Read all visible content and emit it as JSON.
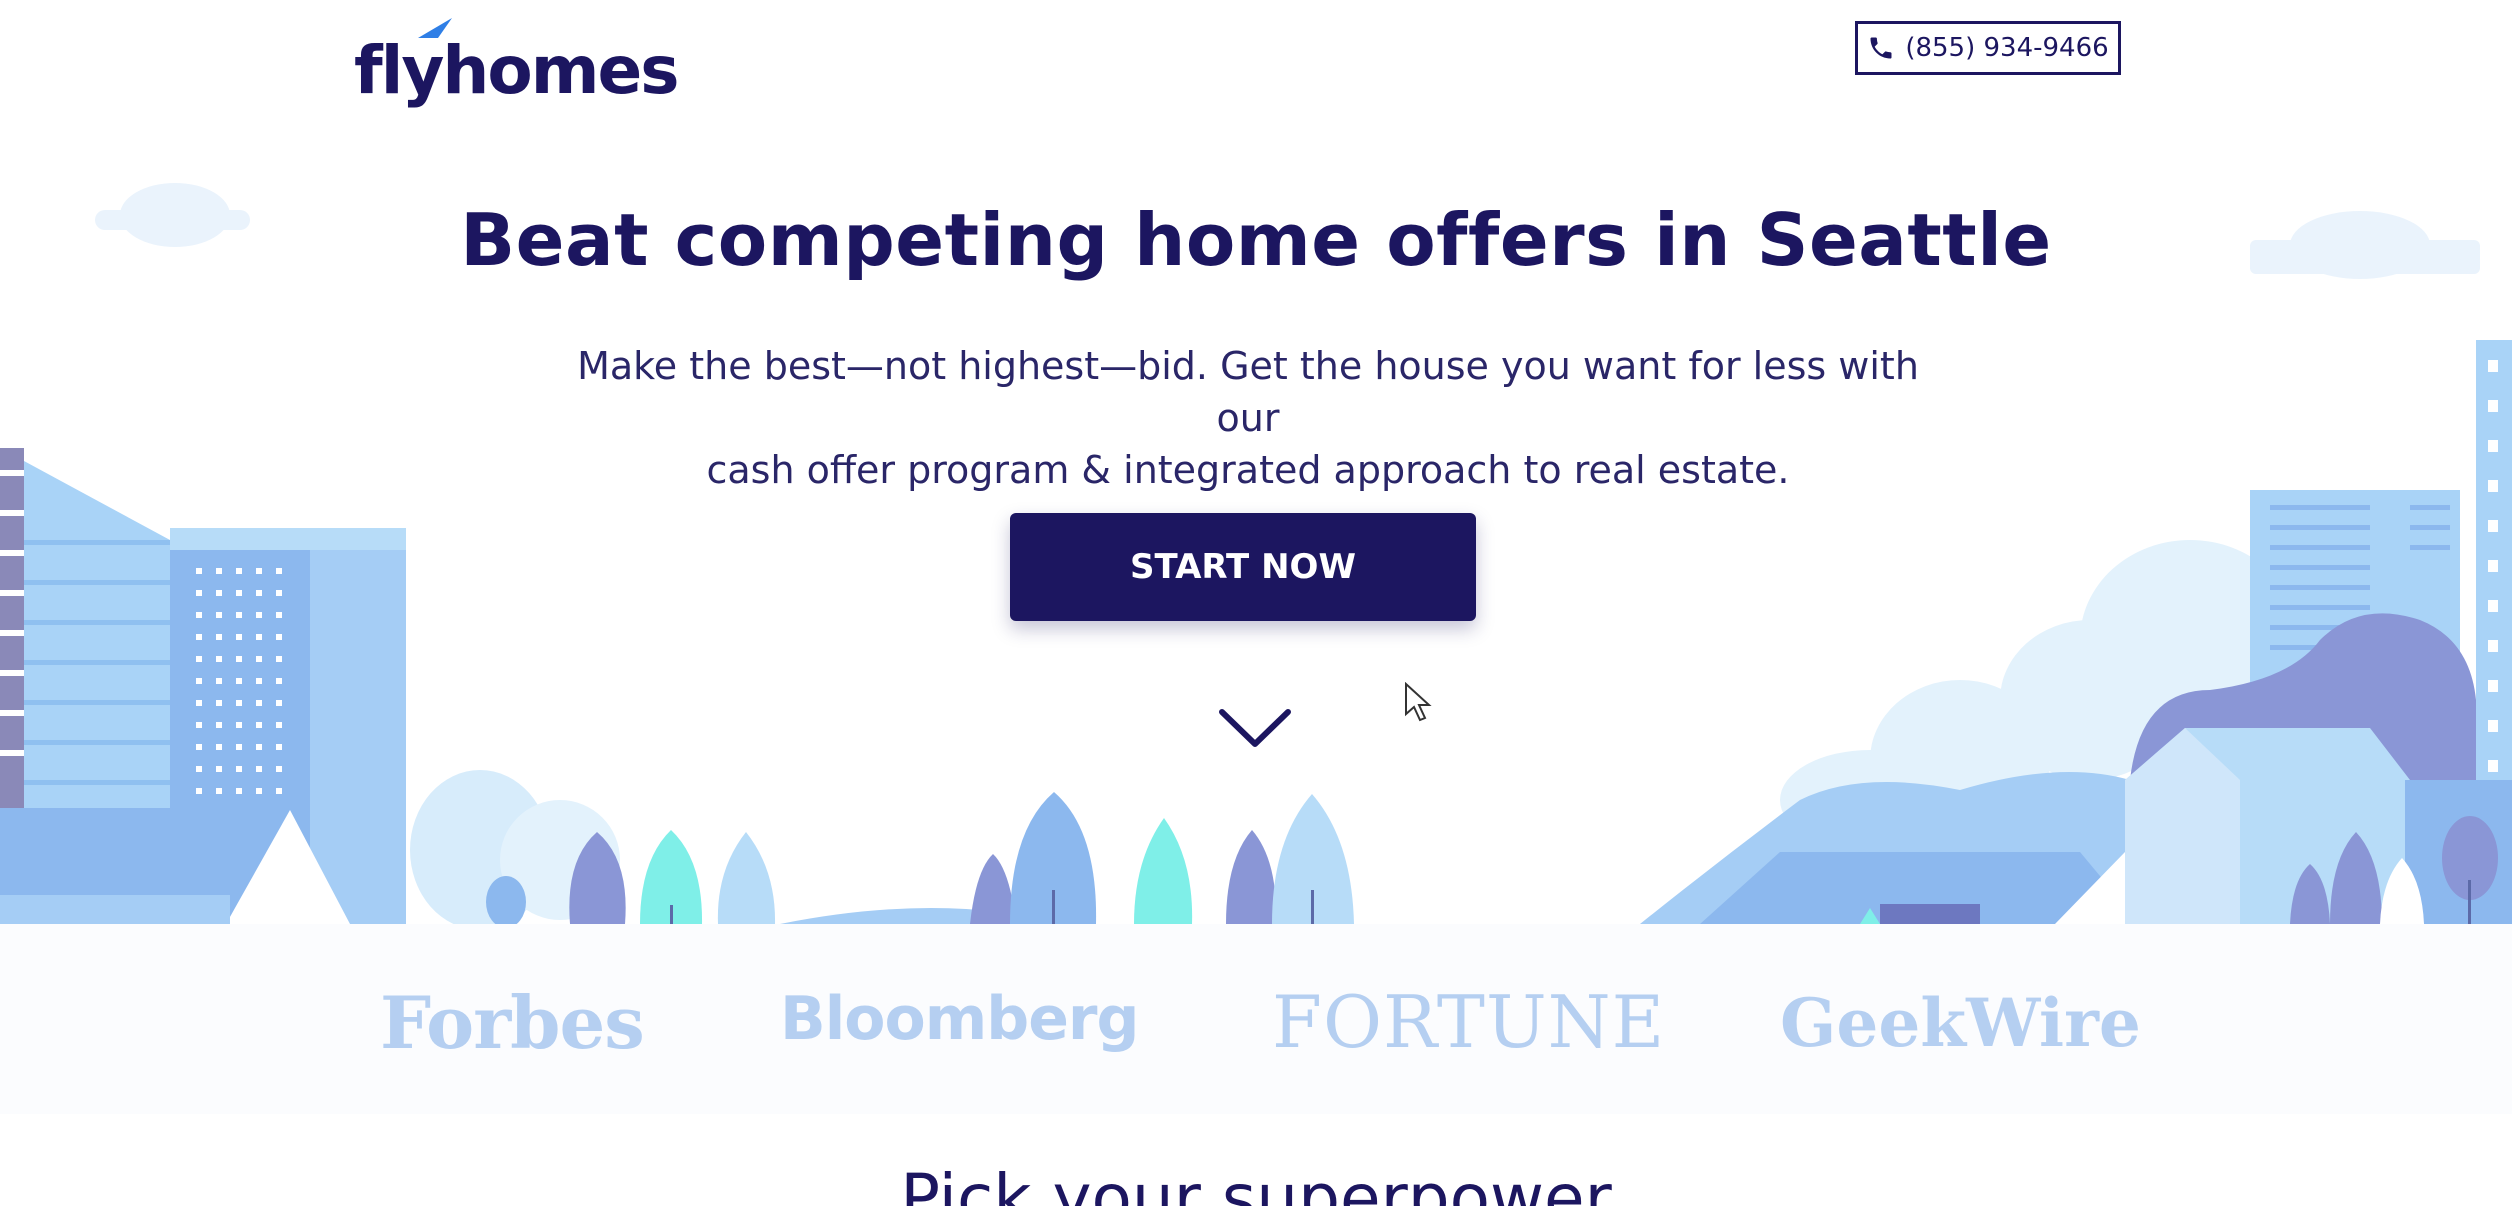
{
  "brand": {
    "logo_text": "flyhomes",
    "primary_color": "#1c1660",
    "accent_color": "#2f7fe6"
  },
  "header": {
    "phone_label": "(855) 934-9466",
    "phone_icon": "phone-icon"
  },
  "hero": {
    "title": "Beat competing home offers in Seattle",
    "subtitle_line1": "Make the best—not highest—bid. Get the house you want for less with our",
    "subtitle_line2": "cash offer program & integrated approach to real estate.",
    "cta_label": "START NOW",
    "scroll_icon": "chevron-down-icon"
  },
  "press": {
    "logos": [
      {
        "name": "Forbes"
      },
      {
        "name": "Bloomberg"
      },
      {
        "name": "FORTUNE"
      },
      {
        "name": "GeekWire"
      }
    ]
  },
  "next_section": {
    "title": "Pick your superpower"
  }
}
